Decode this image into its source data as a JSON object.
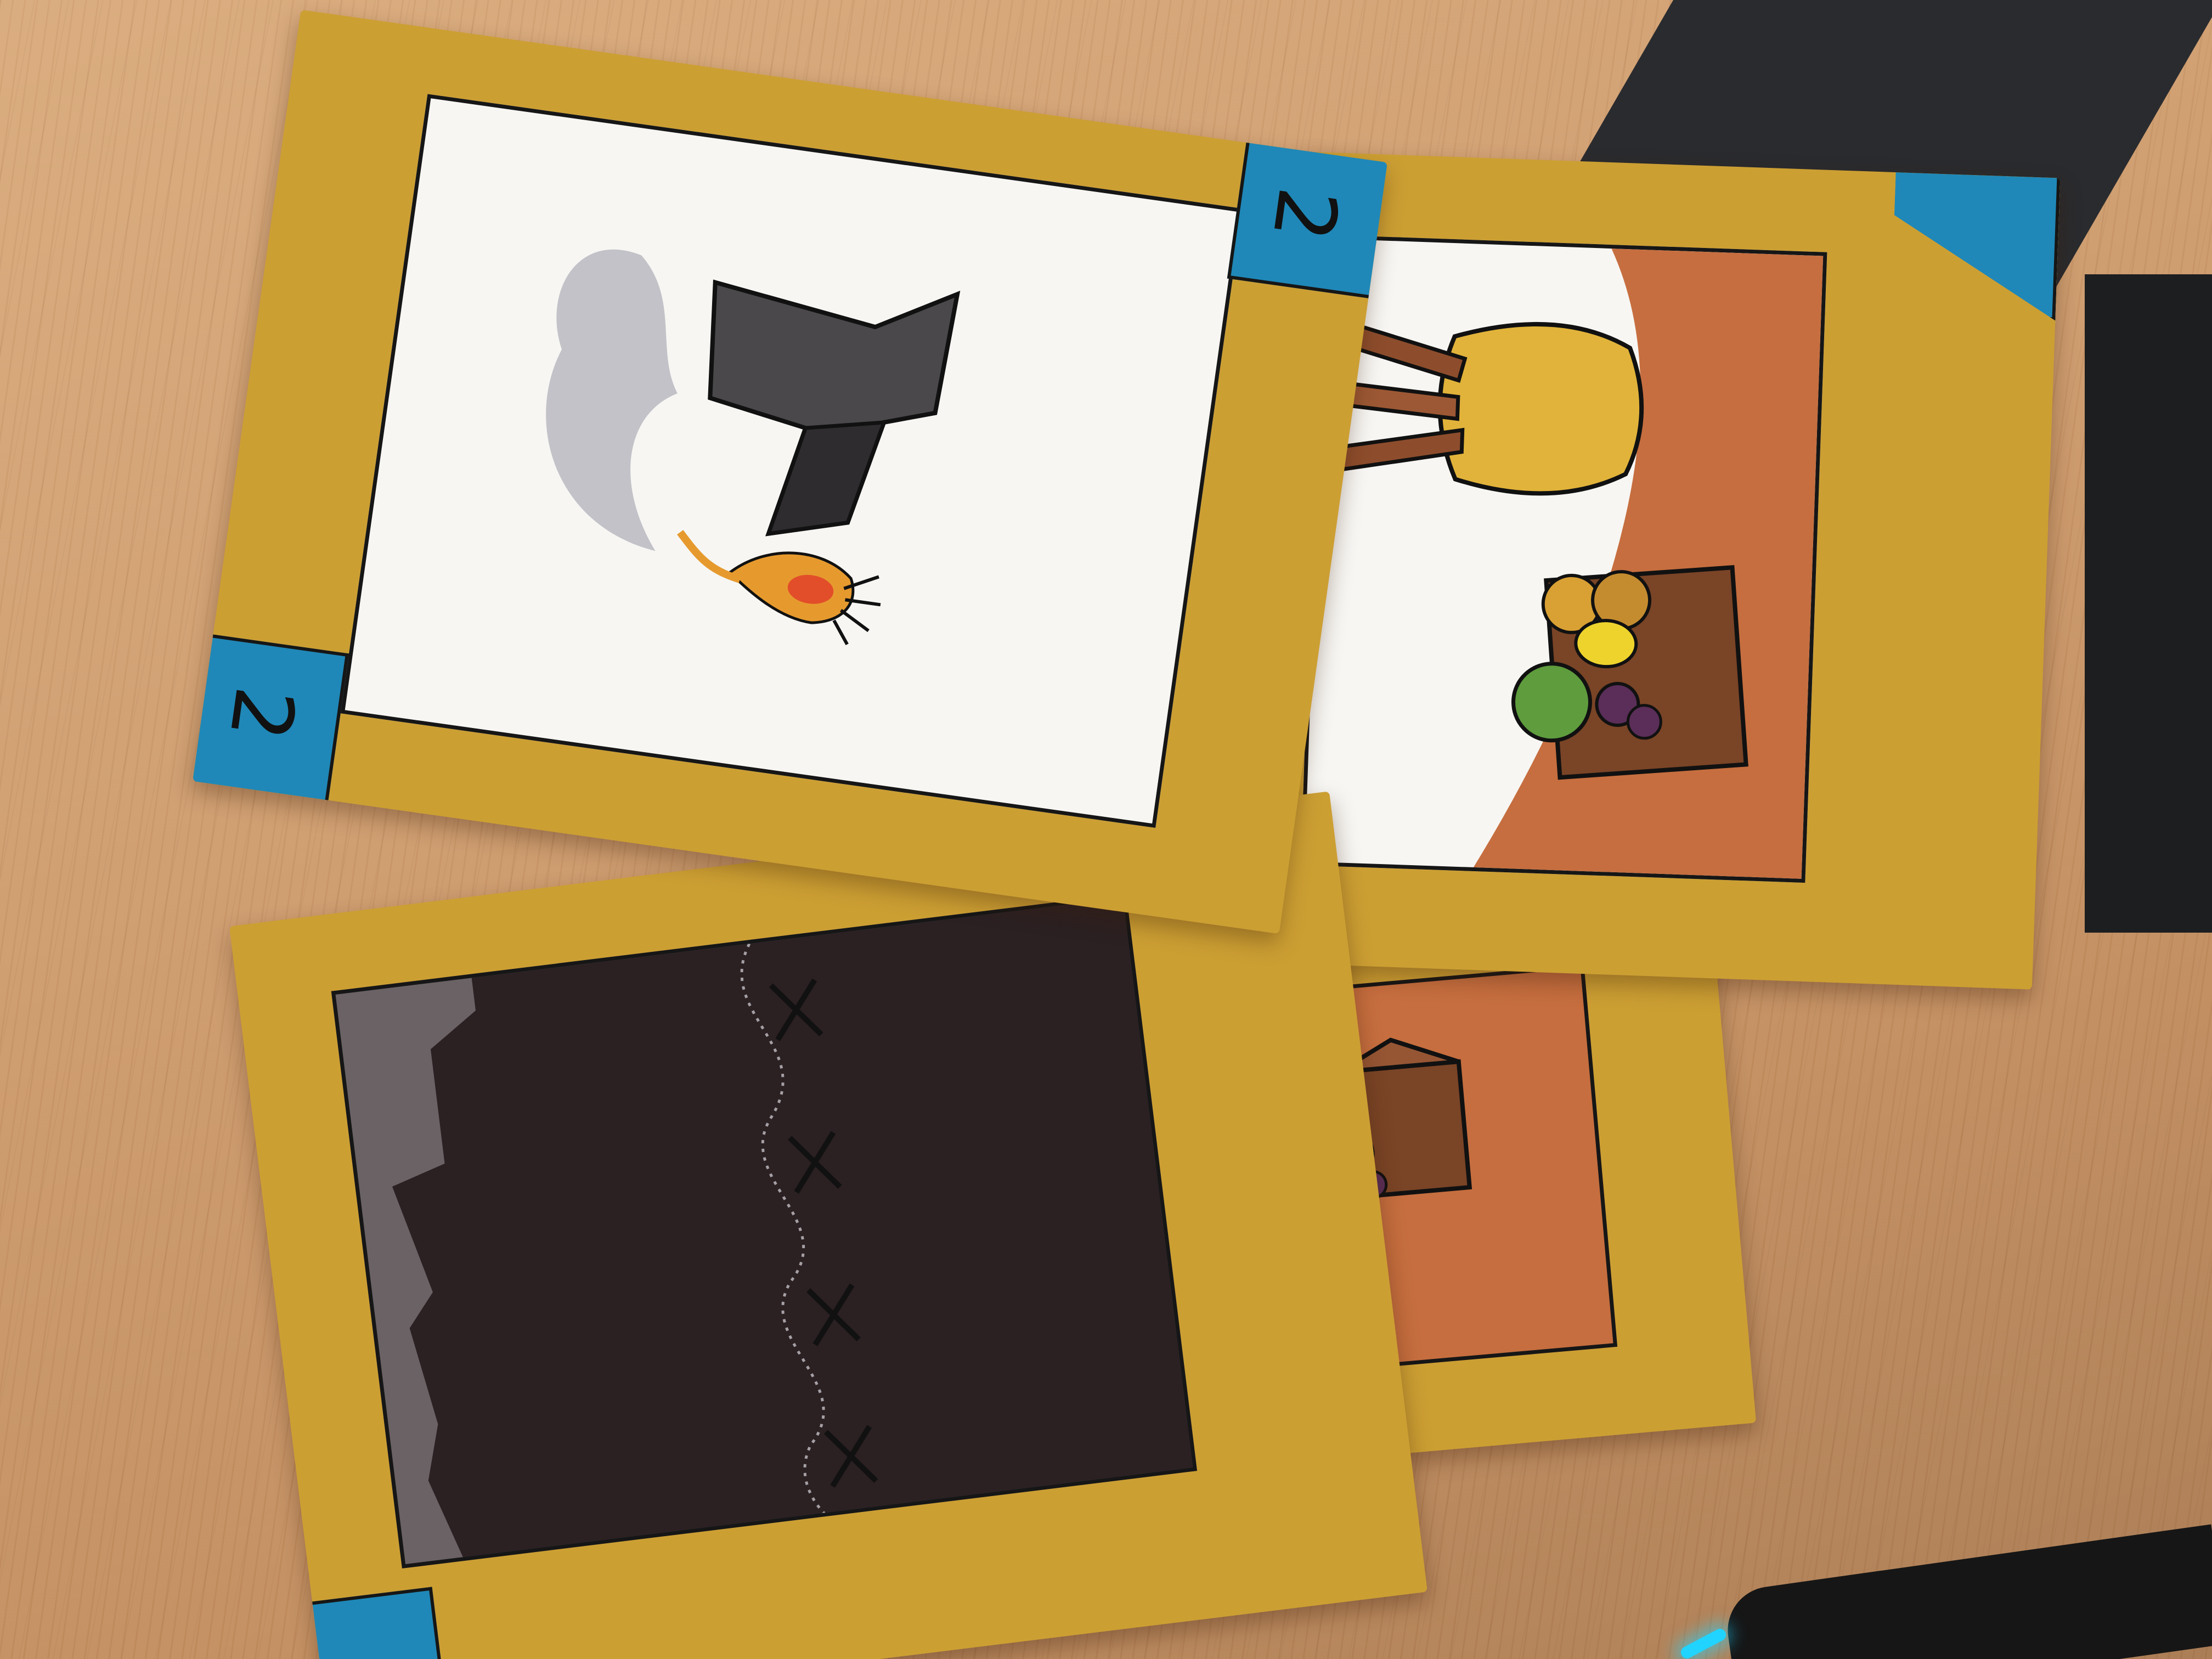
{
  "scene": {
    "description_free": true,
    "colors": {
      "table": "#c99868",
      "card_border": "#cc9f33",
      "card_corner": "#1f88b8",
      "card_outline": "#161616",
      "art_white": "#f7f6f3",
      "art_terracotta": "#c66e3f",
      "art_dark": "#2b2022",
      "art_dark_grey": "#6a6265",
      "accent_led": "#21d4ff"
    }
  },
  "cards": [
    {
      "name": "card-top-left",
      "corner_label": "2",
      "corner_label_left": "2",
      "artwork": "anvil-hat-icon"
    },
    {
      "name": "card-top-right",
      "corner_label": "",
      "artwork": "sack-and-fruit-crate-icon"
    },
    {
      "name": "card-bottom-left",
      "corner_label": "",
      "artwork": "barbed-wire-wall-icon"
    },
    {
      "name": "card-bottom-right",
      "corner_label": "",
      "artwork": "fruit-crate-icon"
    }
  ]
}
